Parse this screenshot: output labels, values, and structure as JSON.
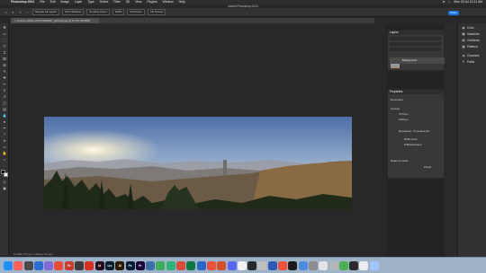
{
  "menubar": {
    "app": "Photoshop 2024",
    "items": [
      "File",
      "Edit",
      "Image",
      "Layer",
      "Type",
      "Select",
      "Filter",
      "3D",
      "View",
      "Plugins",
      "Window",
      "Help"
    ],
    "clock": "Mon 29 Jul 11:21 AM"
  },
  "window_title": "Adobe Photoshop 2024",
  "options_bar": {
    "sample": "Sample All Layers",
    "mode": "Fit to Window",
    "scrubby": "Scrubby Zoom",
    "zoom_pct": "100%",
    "fit_screen": "Fit Screen",
    "fill_screen": "Fill Screen",
    "share": "Share"
  },
  "document_tab": "reverse-sticker-DSC01999HD_stitched.jpg @ 14.3% (RGB/8)",
  "status_text": "14.29%   4773 px × 1400 px (72 ppi)",
  "layers_panel": {
    "title": "Layers",
    "layer_name": "Background"
  },
  "properties_panel": {
    "title": "Properties",
    "doc_label": "Document",
    "canvas_label": "Canvas",
    "w_value": "4773 px",
    "h_value": "1400 px",
    "resolution": "Resolution: 72 pixels/inch",
    "mode": "RGB Color",
    "depth": "8 Bits/Channel",
    "rulers": "Rulers & Grids",
    "pixels": "Pixels"
  },
  "right_panel": {
    "items": [
      "Color",
      "Swatches",
      "Gradients",
      "Patterns",
      "Channels",
      "Paths"
    ]
  },
  "dock": {
    "apps": [
      {
        "label": "",
        "color": "#1e90ff"
      },
      {
        "label": "",
        "color": "#ff5f57"
      },
      {
        "label": "",
        "color": "#4a4a4a"
      },
      {
        "label": "",
        "color": "#2b6fd1"
      },
      {
        "label": "",
        "color": "#7f6ad8"
      },
      {
        "label": "",
        "color": "#e84a3c"
      },
      {
        "label": "Fz",
        "color": "#c93b2c"
      },
      {
        "label": "",
        "color": "#3a3a3a"
      },
      {
        "label": "",
        "color": "#d6301e"
      },
      {
        "label": "Id",
        "color": "#2b0e1c"
      },
      {
        "label": "Lrc",
        "color": "#0a1e2e"
      },
      {
        "label": "Ai",
        "color": "#2e1a00"
      },
      {
        "label": "Ps",
        "color": "#001d34"
      },
      {
        "label": "Pr",
        "color": "#1a0033"
      },
      {
        "label": "",
        "color": "#3a6fa8"
      },
      {
        "label": "",
        "color": "#3cae5c"
      },
      {
        "label": "",
        "color": "#2ab47c"
      },
      {
        "label": "",
        "color": "#d94a3a"
      },
      {
        "label": "",
        "color": "#0d7a45"
      },
      {
        "label": "",
        "color": "#2a63c9"
      },
      {
        "label": "",
        "color": "#e8513c"
      },
      {
        "label": "",
        "color": "#d64f2a"
      },
      {
        "label": "",
        "color": "#5865f2"
      },
      {
        "label": "",
        "color": "#f2f2f2"
      },
      {
        "label": "",
        "color": "#2a2a2a"
      },
      {
        "label": "",
        "color": "#c0c0c0"
      },
      {
        "label": "",
        "color": "#2d5ab5"
      },
      {
        "label": "",
        "color": "#f05138"
      },
      {
        "label": "",
        "color": "#1b1b1b"
      },
      {
        "label": "",
        "color": "#4c8be0"
      },
      {
        "label": "",
        "color": "#8c8c8c"
      },
      {
        "label": "",
        "color": "#e3e3e3"
      },
      {
        "label": "",
        "color": "#b7b7b7"
      },
      {
        "label": "",
        "color": "#4caf50"
      },
      {
        "label": "",
        "color": "#2b2b2b"
      },
      {
        "label": "",
        "color": "#ececec"
      },
      {
        "label": "",
        "color": "#a0c4ff"
      }
    ]
  }
}
